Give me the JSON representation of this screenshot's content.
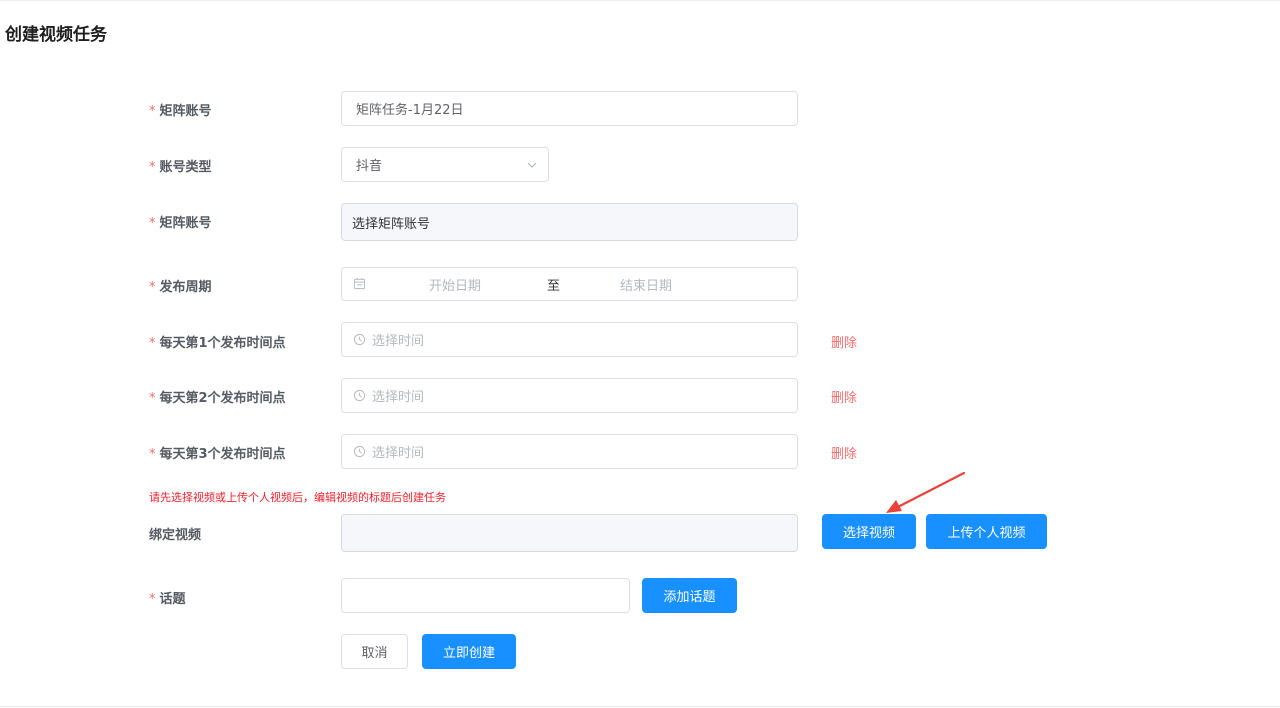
{
  "page": {
    "title": "创建视频任务"
  },
  "colors": {
    "primary": "#1890ff",
    "danger": "#f56c6c",
    "warning_text": "#f5222d",
    "required_mark": "#f56c6c",
    "annotation_arrow": "#e8423a"
  },
  "form": {
    "required_mark": "*",
    "matrix_name": {
      "label": "矩阵账号",
      "value": "矩阵任务-1月22日"
    },
    "account_type": {
      "label": "账号类型",
      "selected": "抖音",
      "icon": "chevron-down-icon"
    },
    "matrix_account": {
      "label": "矩阵账号",
      "value": "选择矩阵账号"
    },
    "publish_period": {
      "label": "发布周期",
      "icon": "calendar-icon",
      "start_placeholder": "开始日期",
      "separator": "至",
      "end_placeholder": "结束日期"
    },
    "time_points": [
      {
        "label": "每天第1个发布时间点",
        "placeholder": "选择时间",
        "delete_label": "删除",
        "icon": "clock-icon"
      },
      {
        "label": "每天第2个发布时间点",
        "placeholder": "选择时间",
        "delete_label": "删除",
        "icon": "clock-icon"
      },
      {
        "label": "每天第3个发布时间点",
        "placeholder": "选择时间",
        "delete_label": "删除",
        "icon": "clock-icon"
      }
    ],
    "video_hint": "请先选择视频或上传个人视频后，编辑视频的标题后创建任务",
    "bind_video": {
      "label": "绑定视频",
      "value": "",
      "select_button": "选择视频",
      "upload_button": "上传个人视频"
    },
    "topic": {
      "label": "话题",
      "value": "",
      "add_button": "添加话题"
    },
    "actions": {
      "cancel": "取消",
      "create": "立即创建"
    }
  }
}
